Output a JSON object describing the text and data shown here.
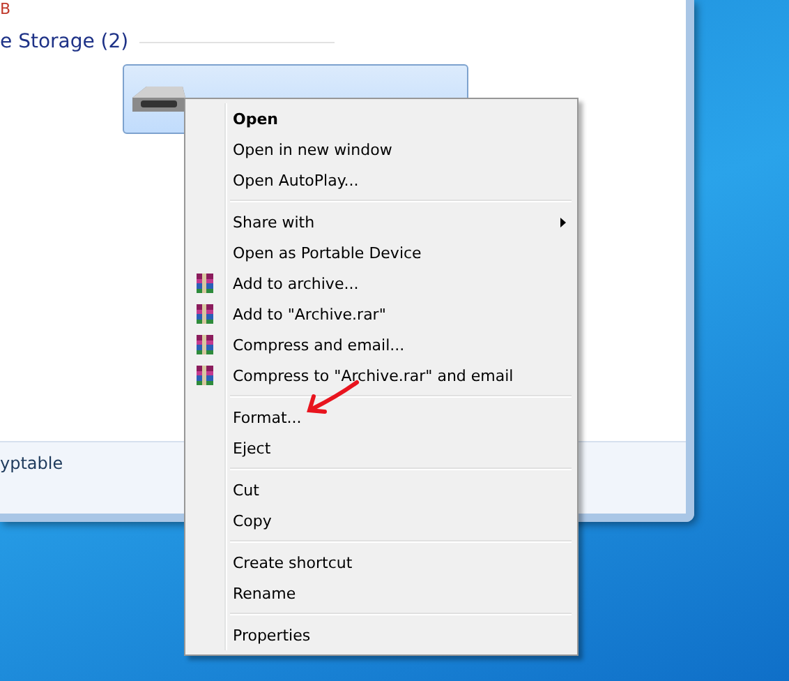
{
  "explorer": {
    "top_fragment": "B",
    "group_header": "e Storage (2)",
    "drive": {
      "selected": true
    },
    "details_text": "yptable"
  },
  "context_menu": {
    "items": [
      {
        "kind": "item",
        "label": "Open",
        "default": true
      },
      {
        "kind": "item",
        "label": "Open in new window",
        "default": false
      },
      {
        "kind": "item",
        "label": "Open AutoPlay...",
        "default": false
      },
      {
        "kind": "separator"
      },
      {
        "kind": "submenu",
        "label": "Share with",
        "default": false
      },
      {
        "kind": "item",
        "label": "Open as Portable Device",
        "default": false
      },
      {
        "kind": "archive",
        "label": "Add to archive...",
        "default": false
      },
      {
        "kind": "archive",
        "label": "Add to \"Archive.rar\"",
        "default": false
      },
      {
        "kind": "archive",
        "label": "Compress and email...",
        "default": false
      },
      {
        "kind": "archive",
        "label": "Compress to \"Archive.rar\" and email",
        "default": false
      },
      {
        "kind": "separator"
      },
      {
        "kind": "item",
        "label": "Format...",
        "default": false
      },
      {
        "kind": "item",
        "label": "Eject",
        "default": false
      },
      {
        "kind": "separator"
      },
      {
        "kind": "item",
        "label": "Cut",
        "default": false
      },
      {
        "kind": "item",
        "label": "Copy",
        "default": false
      },
      {
        "kind": "separator"
      },
      {
        "kind": "item",
        "label": "Create shortcut",
        "default": false
      },
      {
        "kind": "item",
        "label": "Rename",
        "default": false
      },
      {
        "kind": "separator"
      },
      {
        "kind": "item",
        "label": "Properties",
        "default": false
      }
    ]
  }
}
